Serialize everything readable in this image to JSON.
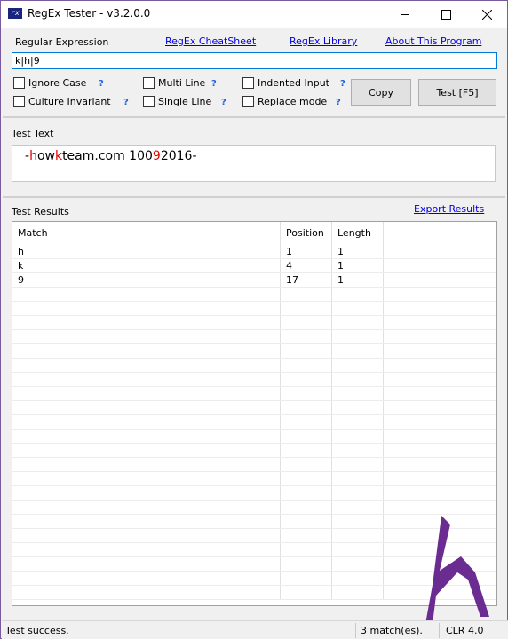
{
  "window": {
    "title": "RegEx Tester - v3.2.0.0",
    "app_icon_text": "rx"
  },
  "regex_panel": {
    "label": "Regular Expression",
    "links": {
      "cheatsheet": "RegEx CheatSheet",
      "library": "RegEx Library",
      "about": "About This Program"
    },
    "expression": "k|h|9",
    "options": {
      "ignore_case": "Ignore Case",
      "culture_invariant": "Culture Invariant",
      "multi_line": "Multi Line",
      "single_line": "Single Line",
      "indented_input": "Indented Input",
      "replace_mode": "Replace mode",
      "help": "?"
    },
    "buttons": {
      "copy": "Copy",
      "test": "Test [F5]"
    }
  },
  "text_panel": {
    "label": "Test Text",
    "segments": [
      {
        "text": "-",
        "hl": false
      },
      {
        "text": "h",
        "hl": true
      },
      {
        "text": "ow",
        "hl": false
      },
      {
        "text": "k",
        "hl": true
      },
      {
        "text": "team.com 100",
        "hl": false
      },
      {
        "text": "9",
        "hl": true
      },
      {
        "text": "2016-",
        "hl": false
      }
    ]
  },
  "results_panel": {
    "label": "Test Results",
    "export_link": "Export Results",
    "columns": [
      "Match",
      "Position",
      "Length"
    ],
    "rows": [
      {
        "match": "h",
        "position": "1",
        "length": "1"
      },
      {
        "match": "k",
        "position": "4",
        "length": "1"
      },
      {
        "match": "9",
        "position": "17",
        "length": "1"
      }
    ]
  },
  "statusbar": {
    "message": "Test success.",
    "count": "3 match(es).",
    "clr": "CLR 4.0"
  },
  "colors": {
    "link": "#0000e0",
    "highlight": "#e00000",
    "logo": "#6a2c91"
  }
}
